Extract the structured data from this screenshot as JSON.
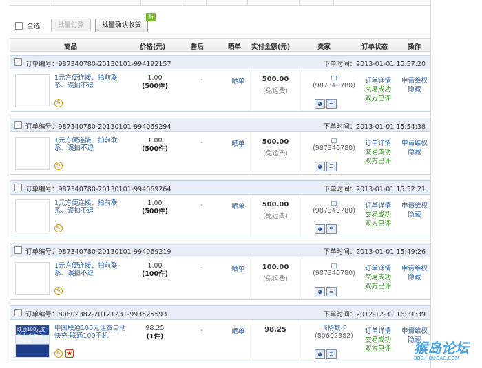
{
  "toolbar": {
    "select_all": "全选",
    "batch_pay": "批量付款",
    "batch_confirm": "批量确认收货",
    "new_badge": "新"
  },
  "columns": {
    "product": "商品",
    "price": "价格(元)",
    "after_sale": "售后",
    "share": "晒单",
    "paid": "实付金额(元)",
    "seller": "卖家",
    "status": "订单状态",
    "ops": "操作"
  },
  "orders": [
    {
      "id_label": "订单编号：987340780-20130101-994192157",
      "time_label": "下单时间：2013-01-01 15:57:20",
      "title": "1元方便连接、拍前联系、误拍不退",
      "price": "1.00",
      "qty": "(500件)",
      "after": "-",
      "share": "晒单",
      "amount": "500.00",
      "shipping": "(免运费)",
      "seller_name": "□",
      "seller_id": "(987340780)",
      "status": [
        "订单详情",
        "交易成功",
        "双方已评"
      ],
      "ops": [
        "申请维权",
        "隐藏"
      ]
    },
    {
      "id_label": "订单编号：987340780-20130101-994069294",
      "time_label": "下单时间：2013-01-01 15:54:38",
      "title": "1元方便连接、拍前联系、误拍不退",
      "price": "1.00",
      "qty": "(500件)",
      "after": "-",
      "share": "晒单",
      "amount": "500.00",
      "shipping": "(免运费)",
      "seller_name": "□",
      "seller_id": "(987340780)",
      "status": [
        "订单详情",
        "交易成功",
        "双方已评"
      ],
      "ops": [
        "申请维权",
        "隐藏"
      ]
    },
    {
      "id_label": "订单编号：987340780-20130101-994069264",
      "time_label": "下单时间：2013-01-01 15:52:21",
      "title": "1元方便连接、拍前联系、误拍不退",
      "price": "1.00",
      "qty": "(500件)",
      "after": "-",
      "share": "晒单",
      "amount": "500.00",
      "shipping": "(免运费)",
      "seller_name": "□",
      "seller_id": "(987340780)",
      "status": [
        "订单详情",
        "交易成功",
        "双方已评"
      ],
      "ops": [
        "申请维权",
        "隐藏"
      ]
    },
    {
      "id_label": "订单编号：987340780-20130101-994069219",
      "time_label": "下单时间：2013-01-01 15:49:26",
      "title": "1元方便连接、拍前联系、误拍不退",
      "price": "1.00",
      "qty": "(100件)",
      "after": "-",
      "share": "晒单",
      "amount": "100.00",
      "shipping": "(免运费)",
      "seller_name": "□",
      "seller_id": "(987340780)",
      "status": [
        "订单详情",
        "交易成功",
        "双方已评"
      ],
      "ops": [
        "申请维权",
        "隐藏"
      ]
    },
    {
      "id_label": "订单编号：80602382-20121231-993525593",
      "time_label": "下单时间：2012-12-31 16:31:39",
      "title": "中国联通100元话费自动快充-联通100手机",
      "price": "98.25",
      "qty": "(1件)",
      "after": "-",
      "share": "晒单",
      "amount": "98.25",
      "shipping": "",
      "seller_name": "飞扬数卡",
      "seller_id": "(80602382)",
      "status": [
        "订单详情",
        "交易成功",
        "双方已评"
      ],
      "ops": [
        "申请维权",
        "隐藏"
      ]
    }
  ],
  "thumb_text": "联通100元充值卡 电脑自动快充",
  "watermark": {
    "big": "猴岛论坛",
    "small": "BBS.HOUDAO.COM"
  }
}
